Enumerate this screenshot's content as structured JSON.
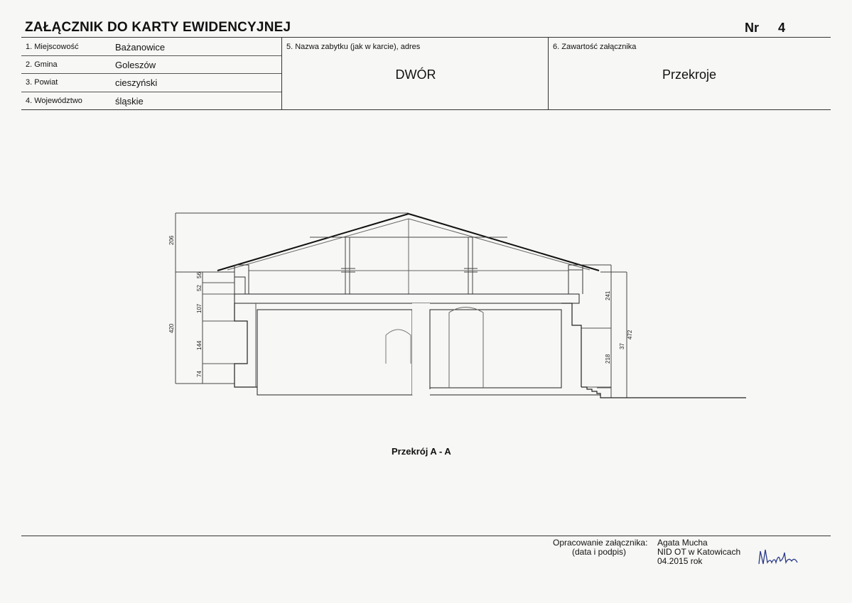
{
  "header": {
    "title": "ZAŁĄCZNIK DO KARTY EWIDENCYJNEJ",
    "nr_label": "Nr",
    "nr_value": "4"
  },
  "info": {
    "fields": [
      {
        "label": "1. Miejscowość",
        "value": "Bażanowice"
      },
      {
        "label": "2. Gmina",
        "value": "Goleszów"
      },
      {
        "label": "3. Powiat",
        "value": "cieszyński"
      },
      {
        "label": "4. Województwo",
        "value": "śląskie"
      }
    ],
    "name_label": "5. Nazwa zabytku (jak w karcie), adres",
    "name_value": "DWÓR",
    "content_label": "6. Zawartość załącznika",
    "content_value": "Przekroje"
  },
  "drawing": {
    "caption": "Przekrój A - A",
    "dims_left": [
      "206",
      "56",
      "52",
      "107",
      "420",
      "144",
      "74"
    ],
    "dims_right": [
      "241",
      "218",
      "37",
      "472"
    ]
  },
  "footer": {
    "prepared_label_1": "Opracowanie załącznika:",
    "prepared_label_2": "(data i podpis)",
    "author": "Agata Mucha",
    "institution": "NID OT w Katowicach",
    "date": "04.2015 rok",
    "signature": "Mucha"
  }
}
